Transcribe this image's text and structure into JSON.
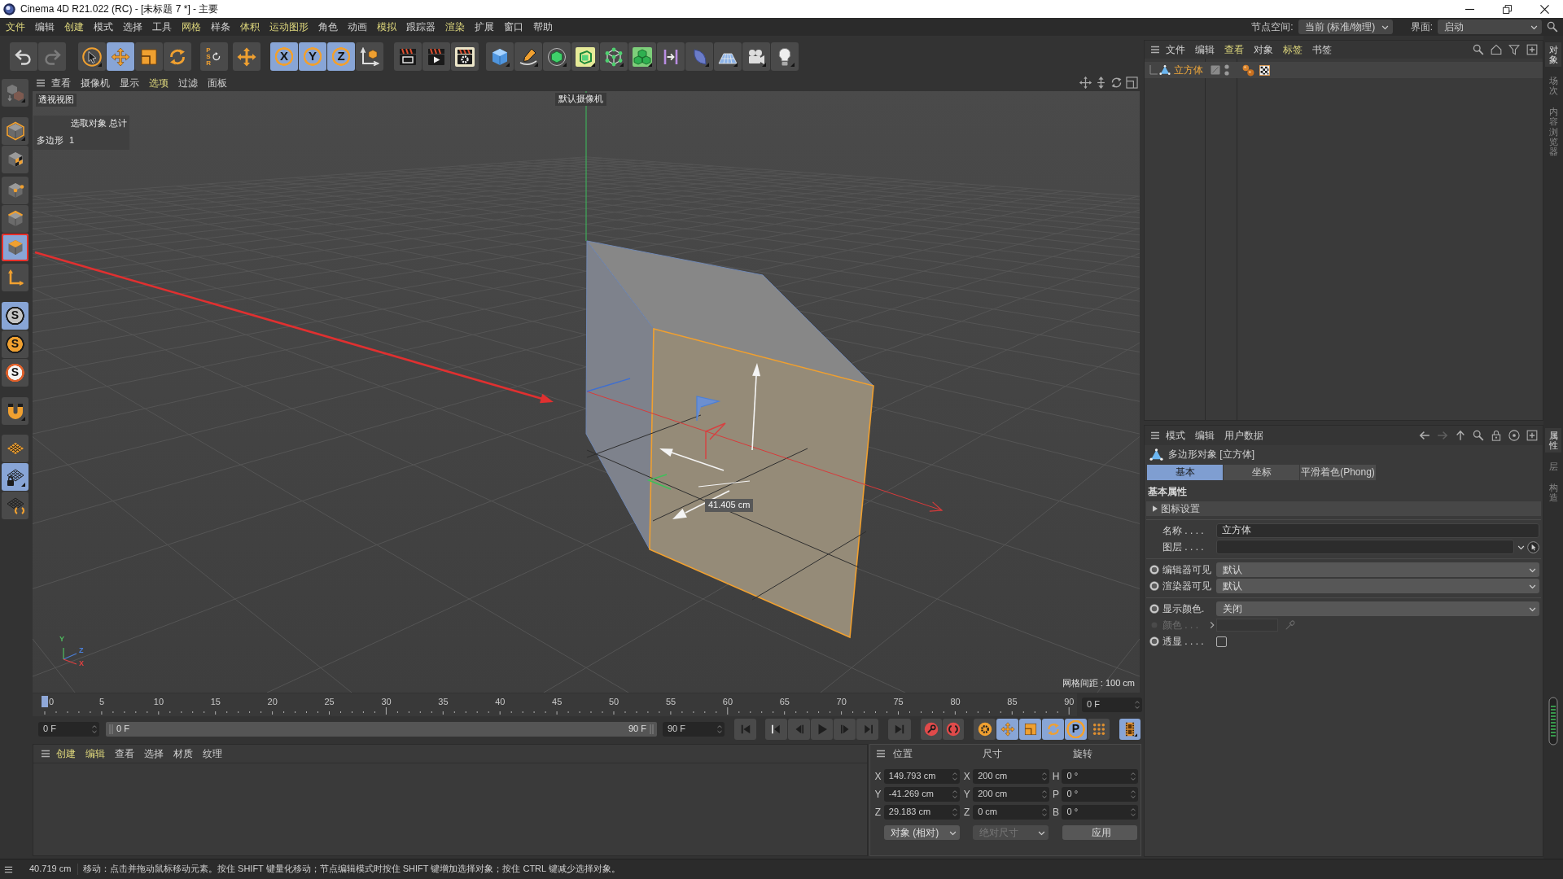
{
  "window": {
    "title": "Cinema 4D R21.022 (RC) - [未标题 7 *] - 主要"
  },
  "menu_bar": {
    "items": [
      {
        "label": "文件",
        "highlighted": true
      },
      {
        "label": "编辑",
        "highlighted": false
      },
      {
        "label": "创建",
        "highlighted": true
      },
      {
        "label": "模式",
        "highlighted": false
      },
      {
        "label": "选择",
        "highlighted": false
      },
      {
        "label": "工具",
        "highlighted": false
      },
      {
        "label": "网格",
        "highlighted": true
      },
      {
        "label": "样条",
        "highlighted": false
      },
      {
        "label": "体积",
        "highlighted": true
      },
      {
        "label": "运动图形",
        "highlighted": true
      },
      {
        "label": "角色",
        "highlighted": false
      },
      {
        "label": "动画",
        "highlighted": false
      },
      {
        "label": "模拟",
        "highlighted": true
      },
      {
        "label": "跟踪器",
        "highlighted": false
      },
      {
        "label": "渲染",
        "highlighted": true
      },
      {
        "label": "扩展",
        "highlighted": false
      },
      {
        "label": "窗口",
        "highlighted": false
      },
      {
        "label": "帮助",
        "highlighted": false
      }
    ],
    "node_space": {
      "label": "节点空间:",
      "value": "当前 (标准/物理)"
    },
    "layout": {
      "label": "界面:",
      "value": "启动"
    }
  },
  "toolbar": [
    [
      {
        "selected": false,
        "disabled": false
      },
      {
        "selected": false,
        "disabled": true
      }
    ],
    [
      {
        "selected": false
      },
      {
        "selected": true
      },
      {
        "selected": false
      },
      {
        "selected": false
      }
    ],
    [
      {
        "label": "PSR",
        "selected": false
      }
    ],
    [
      {
        "selected": false
      }
    ],
    [
      {
        "label": "X",
        "selected": true
      },
      {
        "label": "Y",
        "selected": true
      },
      {
        "label": "Z",
        "selected": true
      },
      {
        "selected": false
      }
    ],
    [
      {
        "selected": false
      },
      {
        "selected": false
      },
      {
        "selected": false
      }
    ],
    [
      {
        "selected": false
      },
      {
        "selected": false
      },
      {
        "selected": false
      },
      {
        "selected": false
      },
      {
        "selected": false
      },
      {
        "selected": false
      },
      {
        "selected": false
      },
      {
        "selected": false
      },
      {
        "selected": false
      },
      {
        "selected": false
      },
      {
        "selected": false
      }
    ]
  ],
  "tool_palette": [
    [
      {
        "selected": false,
        "outlined": false
      }
    ],
    [
      {
        "selected": false,
        "outlined": false
      },
      {
        "selected": false,
        "outlined": false
      }
    ],
    [
      {
        "selected": false,
        "outlined": false
      },
      {
        "selected": false,
        "outlined": false
      },
      {
        "selected": true,
        "outlined": true
      }
    ],
    [
      {
        "selected": false,
        "outlined": false
      }
    ],
    [
      {
        "label": "S",
        "selected": true,
        "outlined": false
      },
      {
        "label": "S",
        "selected": false,
        "outlined": false
      },
      {
        "label": "S",
        "selected": false,
        "outlined": false
      }
    ],
    [
      {
        "selected": false,
        "outlined": false
      }
    ],
    [
      {
        "selected": false,
        "outlined": false
      },
      {
        "selected": true,
        "outlined": false
      },
      {
        "selected": false,
        "outlined": false
      }
    ]
  ],
  "viewport": {
    "menu": [
      {
        "label": "查看",
        "highlighted": false
      },
      {
        "label": "摄像机",
        "highlighted": false
      },
      {
        "label": "显示",
        "highlighted": false
      },
      {
        "label": "选项",
        "highlighted": true
      },
      {
        "label": "过滤",
        "highlighted": false
      },
      {
        "label": "面板",
        "highlighted": false
      }
    ],
    "view_name": "透视视图",
    "camera": "默认摄像机",
    "hud": {
      "header": "选取对象 总计",
      "rows": [
        {
          "label": "多边形",
          "value": "1"
        }
      ]
    },
    "measurement": "41.405 cm",
    "axis_labels": [
      {
        "label": "Y",
        "color": "#4fbf5f"
      },
      {
        "label": "Z",
        "color": "#4a7fd8"
      },
      {
        "label": "X",
        "color": "#e04040"
      }
    ],
    "grid_spacing": "网格间距 : 100 cm"
  },
  "timeline": {
    "ticks": [
      "0",
      "5",
      "10",
      "15",
      "20",
      "25",
      "30",
      "35",
      "40",
      "45",
      "50",
      "55",
      "60",
      "65",
      "70",
      "75",
      "80",
      "85",
      "90"
    ],
    "level": 0,
    "current_frame": "0 F",
    "start_field": "0 F",
    "range": {
      "start": "0 F",
      "end": "90 F"
    },
    "end_field": "90 F",
    "key_tools": [
      {
        "selected": false
      },
      {
        "selected": true
      },
      {
        "selected": true
      },
      {
        "selected": true
      },
      {
        "label": "P",
        "selected": true
      },
      {
        "selected": false
      }
    ],
    "timeline_button": {
      "selected": true
    }
  },
  "material_manager": {
    "menu": [
      {
        "label": "创建",
        "highlighted": true
      },
      {
        "label": "编辑",
        "highlighted": true
      },
      {
        "label": "查看",
        "highlighted": false
      },
      {
        "label": "选择",
        "highlighted": false
      },
      {
        "label": "材质",
        "highlighted": false
      },
      {
        "label": "纹理",
        "highlighted": false
      }
    ]
  },
  "coordinates": {
    "headers": [
      "位置",
      "尺寸",
      "旋转"
    ],
    "rows": [
      {
        "position_axis": "X",
        "position": "149.793 cm",
        "size_axis": "X",
        "size": "200 cm",
        "rotation_axis": "H",
        "rotation": "0 °"
      },
      {
        "position_axis": "Y",
        "position": "-41.269 cm",
        "size_axis": "Y",
        "size": "200 cm",
        "rotation_axis": "P",
        "rotation": "0 °"
      },
      {
        "position_axis": "Z",
        "position": "29.183 cm",
        "size_axis": "Z",
        "size": "0 cm",
        "rotation_axis": "B",
        "rotation": "0 °"
      }
    ],
    "mode": {
      "value": "对象 (相对)",
      "disabled": false
    },
    "size_mode": {
      "value": "绝对尺寸",
      "disabled": true
    },
    "apply": "应用"
  },
  "object_manager": {
    "menu": [
      {
        "label": "文件",
        "highlighted": false
      },
      {
        "label": "编辑",
        "highlighted": false
      },
      {
        "label": "查看",
        "highlighted": true
      },
      {
        "label": "对象",
        "highlighted": false
      },
      {
        "label": "标签",
        "highlighted": true
      },
      {
        "label": "书签",
        "highlighted": false
      }
    ],
    "objects": [
      {
        "name": "立方体",
        "selected": true
      }
    ]
  },
  "attribute_manager": {
    "menu": [
      {
        "label": "模式",
        "highlighted": false
      },
      {
        "label": "编辑",
        "highlighted": false
      },
      {
        "label": "用户数据",
        "highlighted": false
      }
    ],
    "title": "多边形对象 [立方体]",
    "tabs": [
      {
        "label": "基本",
        "selected": true
      },
      {
        "label": "坐标",
        "selected": false
      },
      {
        "label": "平滑着色(Phong)",
        "selected": false
      }
    ],
    "section": "基本属性",
    "group": {
      "label": "图标设置",
      "expanded": false
    },
    "field_groups": [
      [
        {
          "kind": "text",
          "label": "名称 . . . .",
          "value": "立方体",
          "animatable": false,
          "disabled": false
        },
        {
          "kind": "link",
          "label": "图层 . . . .",
          "animatable": false,
          "disabled": false
        }
      ],
      [
        {
          "kind": "select",
          "label": "编辑器可见",
          "value": "默认",
          "animatable": true,
          "disabled": false
        },
        {
          "kind": "select",
          "label": "渲染器可见",
          "value": "默认",
          "animatable": true,
          "disabled": false
        }
      ],
      [
        {
          "kind": "select",
          "label": "显示颜色.",
          "value": "关闭",
          "animatable": true,
          "disabled": false
        },
        {
          "kind": "color",
          "label": "颜色 . . .",
          "animatable": true,
          "disabled": true
        },
        {
          "kind": "checkbox",
          "label": "透显 . . . .",
          "checked": false,
          "animatable": true,
          "disabled": false
        }
      ]
    ]
  },
  "side_tabs": {
    "upper": [
      {
        "label": "对象",
        "selected": true
      },
      {
        "label": "场次",
        "selected": false
      },
      {
        "label": "内容浏览器",
        "selected": false
      }
    ],
    "lower": [
      {
        "label": "属性",
        "selected": true
      },
      {
        "label": "层",
        "selected": false
      },
      {
        "label": "构造",
        "selected": false
      }
    ]
  },
  "status_bar": {
    "readout": "40.719 cm",
    "message": "移动：点击并拖动鼠标移动元素。按住 SHIFT 键量化移动；节点编辑模式时按住 SHIFT 键增加选择对象；按住 CTRL 键减少选择对象。"
  }
}
